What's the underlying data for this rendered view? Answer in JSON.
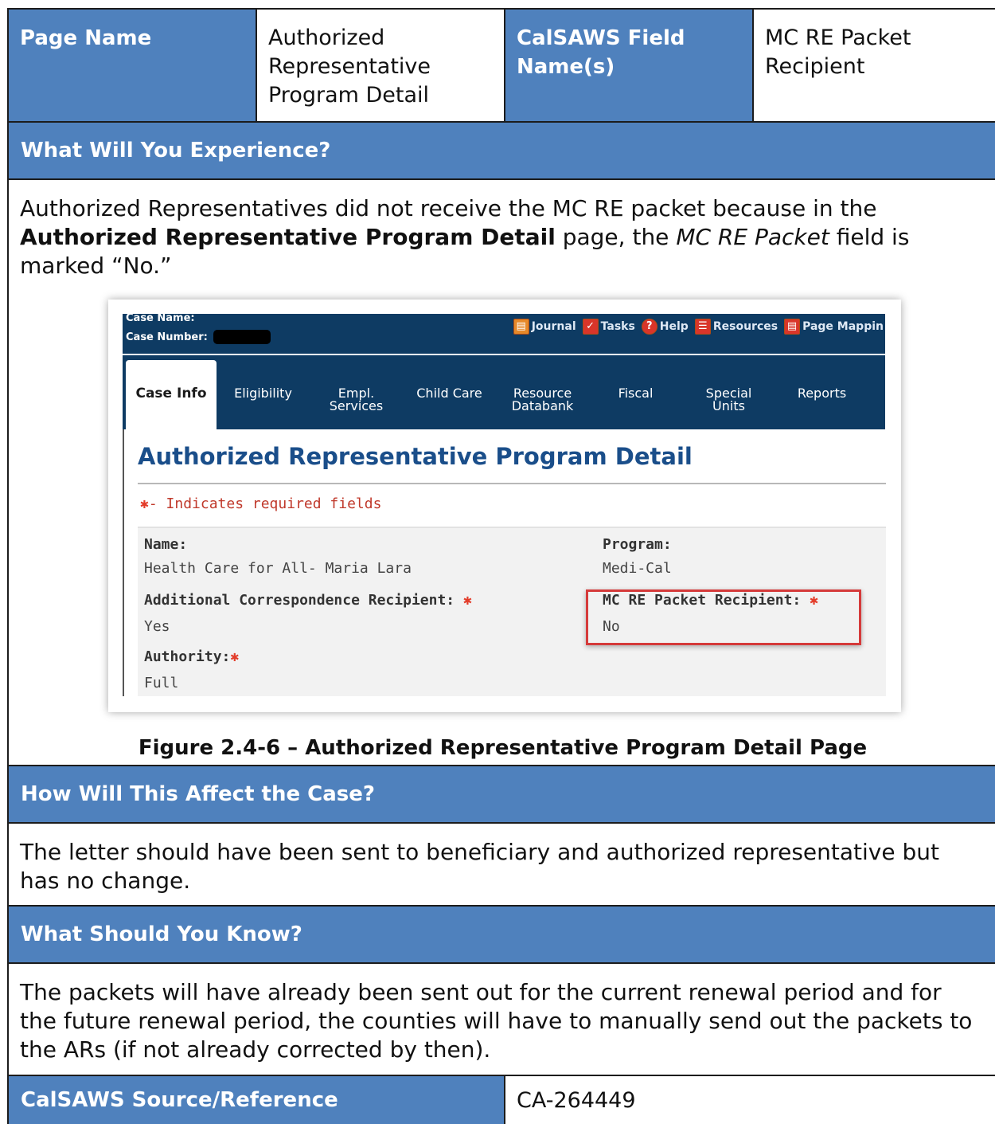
{
  "header_row": {
    "page_name_label": "Page Name",
    "page_name_value": "Authorized Representative Program Detail",
    "field_label": "CalSAWS Field Name(s)",
    "field_value": "MC RE Packet Recipient"
  },
  "experience": {
    "heading": "What Will You Experience?",
    "text_1": "Authorized Representatives did not receive the MC RE packet because in the ",
    "text_bold": "Authorized Representative Program Detail",
    "text_2": " page, the ",
    "text_italic": "MC RE Packet",
    "text_3": " field is marked “No.”"
  },
  "screenshot": {
    "case_name_label": "Case Name:",
    "case_number_label": "Case Number:",
    "top_links": [
      {
        "icon": "journal-icon",
        "label": "Journal"
      },
      {
        "icon": "tasks-icon",
        "label": "Tasks"
      },
      {
        "icon": "help-icon",
        "label": "Help"
      },
      {
        "icon": "resources-icon",
        "label": "Resources"
      },
      {
        "icon": "page-mapping-icon",
        "label": "Page Mappin"
      }
    ],
    "tabs": [
      {
        "line1": "Case Info",
        "line2": ""
      },
      {
        "line1": "Eligibility",
        "line2": ""
      },
      {
        "line1": "Empl.",
        "line2": "Services"
      },
      {
        "line1": "Child Care",
        "line2": ""
      },
      {
        "line1": "Resource",
        "line2": "Databank"
      },
      {
        "line1": "Fiscal",
        "line2": ""
      },
      {
        "line1": "Special",
        "line2": "Units"
      },
      {
        "line1": "Reports",
        "line2": ""
      }
    ],
    "title": "Authorized Representative Program Detail",
    "required_note": "- Indicates required fields",
    "required_star": "✱",
    "fields": {
      "name_label": "Name:",
      "name_value": "Health Care for All- Maria Lara",
      "program_label": "Program:",
      "program_value": "Medi-Cal",
      "acr_label": "Additional Correspondence Recipient:",
      "acr_value": "Yes",
      "mcre_label": "MC RE Packet Recipient:",
      "mcre_value": "No",
      "authority_label": "Authority:",
      "authority_value": "Full"
    },
    "highlight_color": "#d53a3a"
  },
  "figure_caption": "Figure 2.4-6 – Authorized Representative Program Detail Page",
  "affect": {
    "heading": "How Will This Affect the Case?",
    "text": "The letter should have been sent to beneficiary and authorized representative but has no change."
  },
  "know": {
    "heading": "What Should You Know?",
    "text": "The packets will have already been sent out for the current renewal period and for the future renewal period, the counties will have to manually send out the packets to the ARs (if not already corrected by then)."
  },
  "source": {
    "label": "CalSAWS Source/Reference",
    "value": "CA-264449"
  },
  "colors": {
    "header_blue": "#4f81bd",
    "app_navy": "#0e3b63",
    "title_blue": "#1a4e8a"
  }
}
